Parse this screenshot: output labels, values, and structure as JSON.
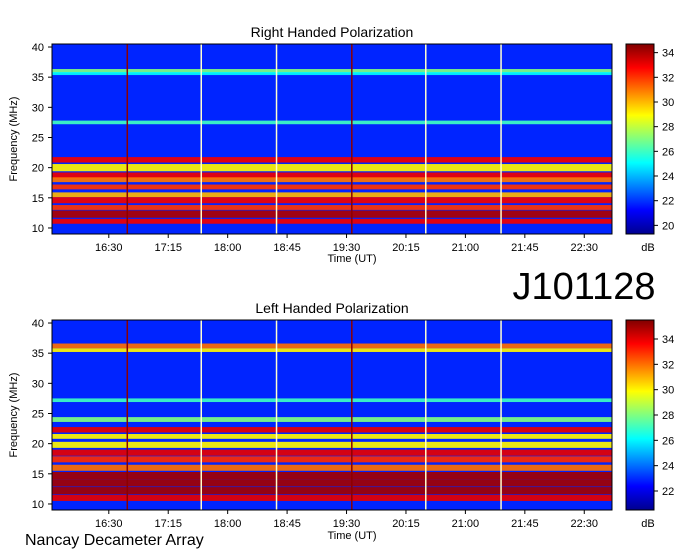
{
  "page": {
    "big_label": "J101128",
    "footer": "Nancay Decameter Array"
  },
  "colors": {
    "colormap": [
      "#00008f",
      "#0000ff",
      "#0080ff",
      "#00ffff",
      "#80ff80",
      "#ffff00",
      "#ff8000",
      "#ff0000",
      "#800000"
    ],
    "vline_dark": "#8b0000",
    "vline_light": "#ffffcc"
  },
  "chart_data": [
    {
      "type": "heatmap",
      "title": "Right Handed Polarization",
      "xlabel": "Time (UT)",
      "ylabel": "Frequency (MHz)",
      "x_ticks": [
        "16:30",
        "17:15",
        "18:00",
        "18:45",
        "19:30",
        "20:15",
        "21:00",
        "21:45",
        "22:30"
      ],
      "x_tick_minutes": [
        990,
        1035,
        1080,
        1125,
        1170,
        1215,
        1260,
        1305,
        1350
      ],
      "xlim_minutes": [
        947,
        1371
      ],
      "y_ticks": [
        10,
        15,
        20,
        25,
        30,
        35,
        40
      ],
      "ylim": [
        9,
        40.5
      ],
      "colorbar": {
        "unit": "dB",
        "ticks": [
          20,
          22,
          24,
          26,
          28,
          30,
          32,
          34
        ],
        "range": [
          19.3,
          34.7
        ]
      },
      "vertical_lines": [
        {
          "minute": 1004,
          "style": "dark"
        },
        {
          "minute": 1060,
          "style": "light"
        },
        {
          "minute": 1117,
          "style": "light"
        },
        {
          "minute": 1174,
          "style": "dark"
        },
        {
          "minute": 1230,
          "style": "light"
        },
        {
          "minute": 1287,
          "style": "light"
        }
      ],
      "bands": [
        {
          "freq": 36.0,
          "width": 0.35,
          "db": 27
        },
        {
          "freq": 35.6,
          "width": 0.25,
          "db": 25
        },
        {
          "freq": 27.5,
          "width": 0.3,
          "db": 26
        },
        {
          "freq": 21.3,
          "width": 0.45,
          "db": 33
        },
        {
          "freq": 20.0,
          "width": 0.6,
          "db": 29
        },
        {
          "freq": 18.7,
          "width": 0.5,
          "db": 33
        },
        {
          "freq": 18.0,
          "width": 0.4,
          "db": 31
        },
        {
          "freq": 16.8,
          "width": 0.4,
          "db": 32
        },
        {
          "freq": 15.5,
          "width": 0.4,
          "db": 30
        },
        {
          "freq": 14.6,
          "width": 0.5,
          "db": 33
        },
        {
          "freq": 13.4,
          "width": 0.4,
          "db": 32
        },
        {
          "freq": 12.3,
          "width": 0.6,
          "db": 34
        },
        {
          "freq": 11.1,
          "width": 0.4,
          "db": 33
        }
      ]
    },
    {
      "type": "heatmap",
      "title": "Left Handed Polarization",
      "xlabel": "Time (UT)",
      "ylabel": "Frequency (MHz)",
      "x_ticks": [
        "16:30",
        "17:15",
        "18:00",
        "18:45",
        "19:30",
        "20:15",
        "21:00",
        "21:45",
        "22:30"
      ],
      "x_tick_minutes": [
        990,
        1035,
        1080,
        1125,
        1170,
        1215,
        1260,
        1305,
        1350
      ],
      "xlim_minutes": [
        947,
        1371
      ],
      "y_ticks": [
        10,
        15,
        20,
        25,
        30,
        35,
        40
      ],
      "ylim": [
        9,
        40.5
      ],
      "colorbar": {
        "unit": "dB",
        "ticks": [
          22,
          24,
          26,
          28,
          30,
          32,
          34
        ],
        "range": [
          20.5,
          35.5
        ]
      },
      "vertical_lines": [
        {
          "minute": 1004,
          "style": "dark"
        },
        {
          "minute": 1060,
          "style": "light"
        },
        {
          "minute": 1117,
          "style": "light"
        },
        {
          "minute": 1174,
          "style": "dark"
        },
        {
          "minute": 1230,
          "style": "light"
        },
        {
          "minute": 1287,
          "style": "light"
        }
      ],
      "bands": [
        {
          "freq": 36.2,
          "width": 0.4,
          "db": 32
        },
        {
          "freq": 35.5,
          "width": 0.3,
          "db": 30
        },
        {
          "freq": 27.2,
          "width": 0.3,
          "db": 27
        },
        {
          "freq": 24.0,
          "width": 0.4,
          "db": 28
        },
        {
          "freq": 22.3,
          "width": 0.45,
          "db": 34
        },
        {
          "freq": 21.2,
          "width": 0.4,
          "db": 30
        },
        {
          "freq": 19.8,
          "width": 0.5,
          "db": 30
        },
        {
          "freq": 18.5,
          "width": 0.5,
          "db": 34
        },
        {
          "freq": 17.4,
          "width": 0.5,
          "db": 33
        },
        {
          "freq": 16.0,
          "width": 0.5,
          "db": 32
        },
        {
          "freq": 14.7,
          "width": 0.6,
          "db": 35
        },
        {
          "freq": 13.5,
          "width": 0.6,
          "db": 35
        },
        {
          "freq": 12.2,
          "width": 0.6,
          "db": 35
        },
        {
          "freq": 11.0,
          "width": 0.5,
          "db": 34
        }
      ]
    }
  ]
}
